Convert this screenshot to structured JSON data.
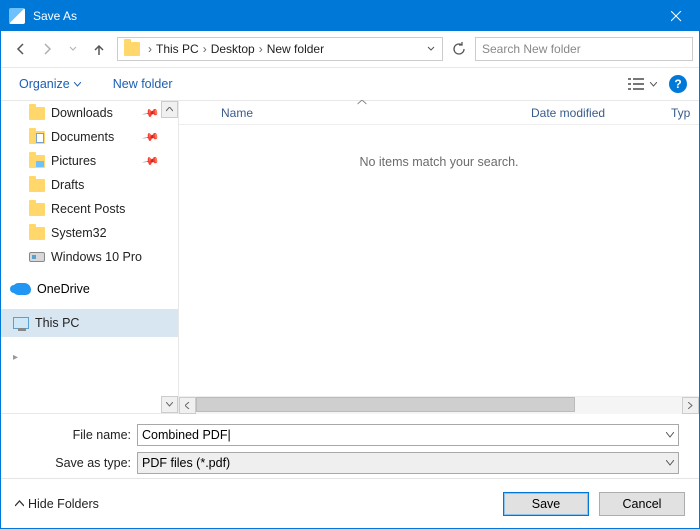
{
  "titlebar": {
    "title": "Save As"
  },
  "nav": {
    "breadcrumb": [
      "This PC",
      "Desktop",
      "New folder"
    ],
    "search_placeholder": "Search New folder"
  },
  "toolbar": {
    "organize": "Organize",
    "new_folder": "New folder"
  },
  "tree": {
    "items": [
      {
        "label": "Downloads",
        "icon": "folder",
        "pinned": true
      },
      {
        "label": "Documents",
        "icon": "docs",
        "pinned": true
      },
      {
        "label": "Pictures",
        "icon": "pics",
        "pinned": true
      },
      {
        "label": "Drafts",
        "icon": "folder",
        "pinned": false
      },
      {
        "label": "Recent Posts",
        "icon": "folder",
        "pinned": false
      },
      {
        "label": "System32",
        "icon": "folder",
        "pinned": false
      },
      {
        "label": "Windows 10 Pro",
        "icon": "disk",
        "pinned": false
      }
    ],
    "groups": [
      {
        "label": "OneDrive",
        "icon": "onedrive",
        "selected": false
      },
      {
        "label": "This PC",
        "icon": "thispc",
        "selected": true
      }
    ]
  },
  "columns": {
    "name": "Name",
    "date": "Date modified",
    "type": "Typ"
  },
  "filearea": {
    "empty_message": "No items match your search."
  },
  "inputs": {
    "filename_label": "File name:",
    "filename_value": "Combined PDF",
    "savetype_label": "Save as type:",
    "savetype_value": "PDF files (*.pdf)"
  },
  "footer": {
    "hide_folders": "Hide Folders",
    "save": "Save",
    "cancel": "Cancel"
  }
}
